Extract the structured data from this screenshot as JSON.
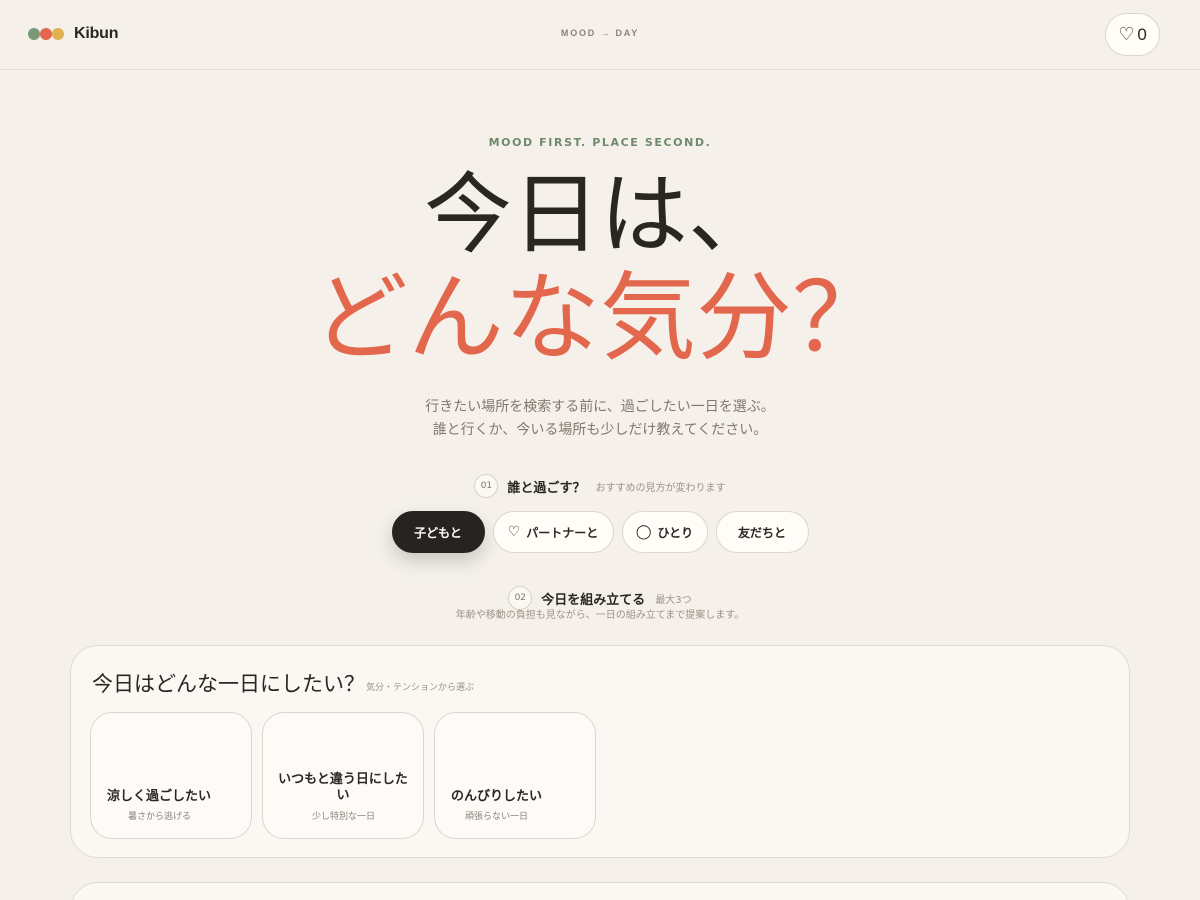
{
  "header": {
    "logo_text": "Kibun",
    "logo_colors": [
      "#7a9a77",
      "#e3674d",
      "#e0b254"
    ],
    "tagline": "MOOD → DAY",
    "favorites_count": "0",
    "heart_icon": "♡"
  },
  "hero": {
    "eyebrow": "MOOD FIRST. PLACE SECOND.",
    "line1": "今日は、",
    "line2": "どんな気分？",
    "accent_color": "#e3674d",
    "subtitle_line1": "行きたい場所を検索する前に、過ごしたい一日を選ぶ。",
    "subtitle_line2": "誰と行くか、今いる場所も少しだけ教えてください。"
  },
  "step1": {
    "number": "01",
    "title": "誰と過ごす？",
    "hint": "おすすめの見方が変わります",
    "companions": [
      {
        "label": "子どもと",
        "icon": "",
        "active": true
      },
      {
        "label": "パートナーと",
        "icon": "♡",
        "active": false
      },
      {
        "label": "ひとり",
        "icon": "◯",
        "active": false
      },
      {
        "label": "友だちと",
        "icon": "",
        "active": false
      }
    ]
  },
  "step2": {
    "number": "02",
    "title": "今日を組み立てる",
    "hint": "最大3つ",
    "description": "年齢や移動の負担も見ながら、一日の組み立てまで提案します。"
  },
  "mood_panel": {
    "title": "今日はどんな一日にしたい？",
    "hint": "気分・テンションから選ぶ",
    "moods": [
      {
        "title": "涼しく過ごしたい",
        "subtitle": "暑さから逃げる"
      },
      {
        "title": "いつもと違う日にしたい",
        "subtitle": "少し特別な一日"
      },
      {
        "title": "のんびりしたい",
        "subtitle": "頑張らない一日"
      }
    ]
  }
}
